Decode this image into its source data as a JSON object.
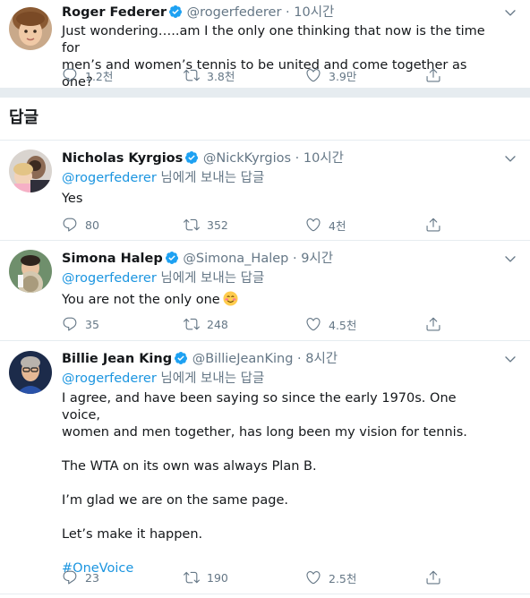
{
  "main_tweet": {
    "name": "Roger Federer",
    "handle": "@rogerfederer",
    "time": "10시간",
    "text": "Just wondering…..am I the only one thinking that now is the time for men’s and women’s tennis to be united and come together as one?",
    "text_line1": "Just wondering…..am I the only one thinking that now is the time for",
    "text_line2": "men’s and women’s tennis to be united and come together as one?",
    "reply_count": "1.2천",
    "retweet_count": "3.8천",
    "like_count": "3.9만"
  },
  "replies_header": "답글",
  "replies": [
    {
      "name": "Nicholas Kyrgios",
      "handle": "@NickKyrgios",
      "time": "10시간",
      "reply_to_mention": "@rogerfederer",
      "reply_to_suffix": " 님에게 보내는 답글",
      "text": "Yes",
      "reply_count": "80",
      "retweet_count": "352",
      "like_count": "4천"
    },
    {
      "name": "Simona Halep",
      "handle": "@Simona_Halep",
      "time": "9시간",
      "reply_to_mention": "@rogerfederer",
      "reply_to_suffix": " 님에게 보내는 답글",
      "text": "You are not the only one",
      "emoji": "smiling-face-emoji",
      "reply_count": "35",
      "retweet_count": "248",
      "like_count": "4.5천"
    },
    {
      "name": "Billie Jean King",
      "handle": "@BillieJeanKing",
      "time": "8시간",
      "reply_to_mention": "@rogerfederer",
      "reply_to_suffix": " 님에게 보내는 답글",
      "text_p1_line1": "I agree, and have been saying so since the early 1970s. One voice,",
      "text_p1_line2": "women and men together, has long been my vision for tennis.",
      "text_p2": "The WTA on its own was always Plan B.",
      "text_p3": "I’m glad we are on the same page.",
      "text_p4": "Let’s make it happen.",
      "hashtag": "#OneVoice",
      "reply_count": "23",
      "retweet_count": "190",
      "like_count": "2.5천"
    }
  ],
  "colors": {
    "link": "#1b95e0",
    "muted": "#657786",
    "verified": "#1da1f2",
    "separator": "#e6ecf0"
  },
  "icons": [
    "verified-badge-icon",
    "chevron-down-icon",
    "reply-icon",
    "retweet-icon",
    "like-icon",
    "share-icon"
  ]
}
